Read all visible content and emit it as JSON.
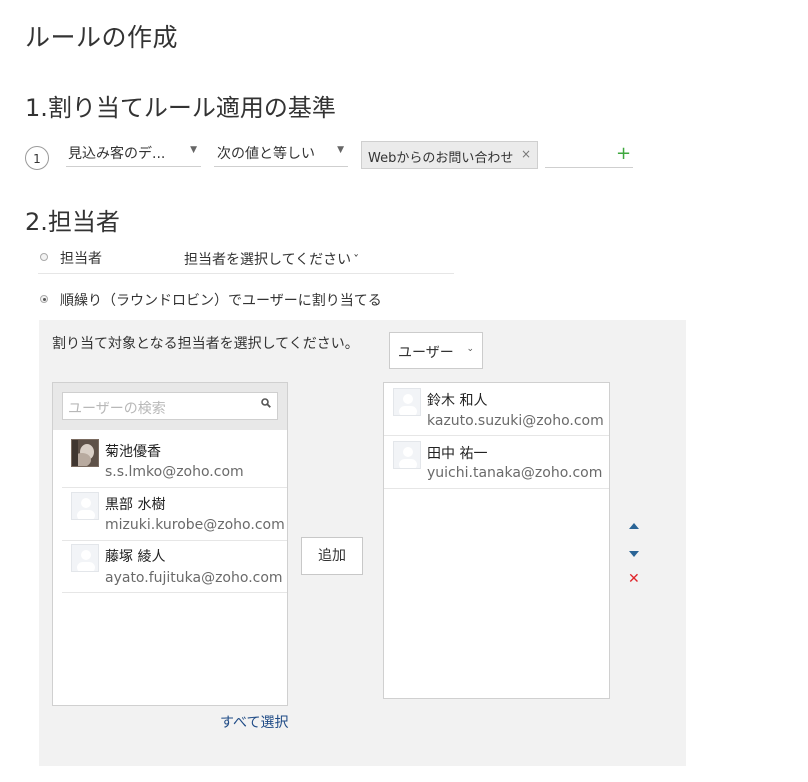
{
  "page": {
    "title": "ルールの作成"
  },
  "section1": {
    "title": "1.割り当てルール適用の基準",
    "criteria": {
      "index": "1",
      "field": "見込み客のデ...",
      "operator": "次の値と等しい",
      "value_chip": "Webからのお問い合わせ",
      "chip_remove": "×",
      "add_symbol": "+"
    }
  },
  "section2": {
    "title": "2.担当者",
    "option_owner": {
      "label": "担当者",
      "select_placeholder": "担当者を選択してください",
      "caret": "ˇ"
    },
    "option_round_robin": {
      "label": "順繰り（ラウンドロビン）でユーザーに割り当てる",
      "instruction": "割り当て対象となる担当者を選択してください。",
      "type_select": "ユーザー",
      "search_placeholder": "ユーザーの検索",
      "available_users": [
        {
          "name": "菊池優香",
          "email": "s.s.lmko@zoho.com"
        },
        {
          "name": "黒部 水樹",
          "email": "mizuki.kurobe@zoho.com"
        },
        {
          "name": "藤塚 綾人",
          "email": "ayato.fujituka@zoho.com"
        }
      ],
      "add_label": "追加",
      "select_all_label": "すべて選択",
      "selected_users": [
        {
          "name": "鈴木 和人",
          "email": "kazuto.suzuki@zoho.com"
        },
        {
          "name": "田中 祐一",
          "email": "yuichi.tanaka@zoho.com"
        }
      ]
    }
  },
  "colors": {
    "accent_plus": "#3fa83f",
    "link": "#1f4b86",
    "move_arrows": "#2a6496",
    "delete": "#e0242a",
    "panel_bg": "#f2f2f2"
  }
}
